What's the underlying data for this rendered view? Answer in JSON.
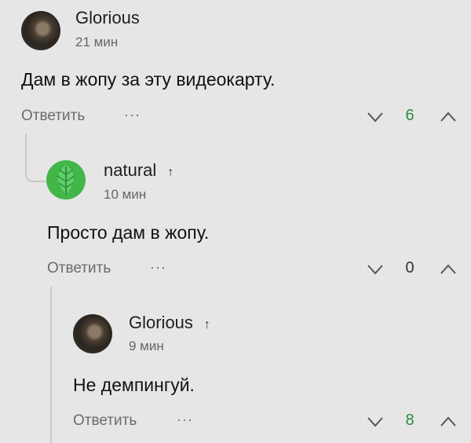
{
  "comments": [
    {
      "author": "Glorious",
      "time": "21 мин",
      "text": "Дам в жопу за эту видеокарту.",
      "reply_label": "Ответить",
      "more": "···",
      "score": "6",
      "score_color": "#2e8b3a"
    },
    {
      "author": "natural",
      "author_badge": "↑",
      "time": "10 мин",
      "text": "Просто дам в жопу.",
      "reply_label": "Ответить",
      "more": "···",
      "score": "0",
      "score_color": "#333333"
    },
    {
      "author": "Glorious",
      "author_badge": "↑",
      "time": "9 мин",
      "text": "Не демпингуй.",
      "reply_label": "Ответить",
      "more": "···",
      "score": "8",
      "score_color": "#2e8b3a"
    }
  ],
  "icons": {
    "avatar_1": "person-photo-avatar",
    "avatar_2": "leaf-avatar",
    "avatar_3": "person-photo-avatar",
    "downvote": "chevron-down-icon",
    "upvote": "chevron-up-icon"
  }
}
